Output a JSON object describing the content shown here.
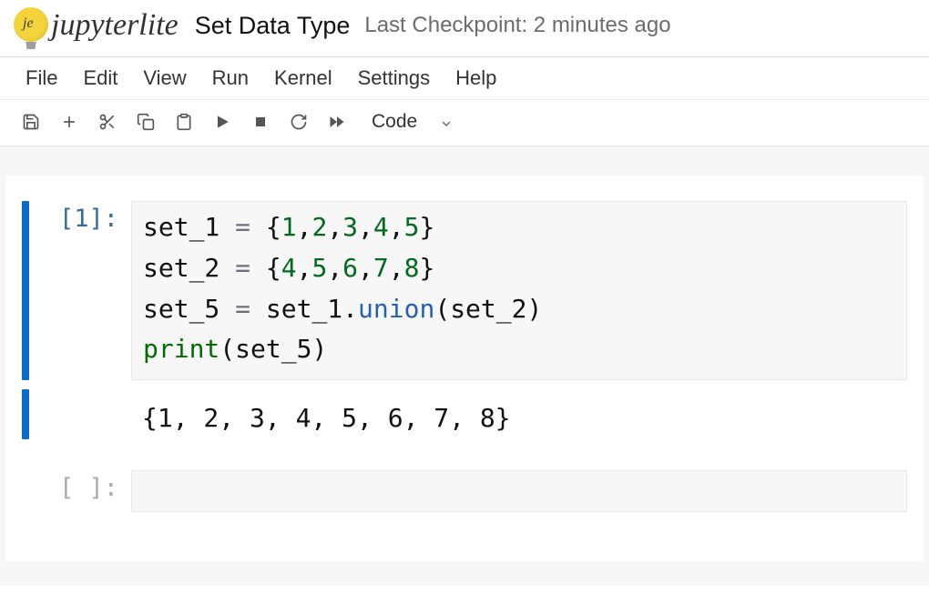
{
  "logo": {
    "short": "je",
    "text": "jupyterlite"
  },
  "notebook_title": "Set Data Type",
  "checkpoint": "Last Checkpoint: 2 minutes ago",
  "menu": {
    "file": "File",
    "edit": "Edit",
    "view": "View",
    "run": "Run",
    "kernel": "Kernel",
    "settings": "Settings",
    "help": "Help"
  },
  "toolbar": {
    "celltype": "Code"
  },
  "cell1": {
    "prompt_open": "[",
    "prompt_num": "1",
    "prompt_close": "]:",
    "line1": {
      "a": "set_1 ",
      "eq": "=",
      "sp": " ",
      "lb": "{",
      "n1": "1",
      "c1": ",",
      "n2": "2",
      "c2": ",",
      "n3": "3",
      "c3": ",",
      "n4": "4",
      "c4": ",",
      "n5": "5",
      "rb": "}"
    },
    "line2": {
      "a": "set_2 ",
      "eq": "=",
      "sp": " ",
      "lb": "{",
      "n1": "4",
      "c1": ",",
      "n2": "5",
      "c2": ",",
      "n3": "6",
      "c3": ",",
      "n4": "7",
      "c4": ",",
      "n5": "8",
      "rb": "}"
    },
    "line3": {
      "a": "set_5 ",
      "eq": "=",
      "sp": " set_1",
      "dot": ".",
      "fn": "union",
      "lp": "(",
      "arg": "set_2",
      "rp": ")"
    },
    "line4": {
      "fn": "print",
      "lp": "(",
      "arg": "set_5",
      "rp": ")"
    },
    "output": "{1, 2, 3, 4, 5, 6, 7, 8}"
  },
  "cell2": {
    "prompt": "[ ]:"
  }
}
